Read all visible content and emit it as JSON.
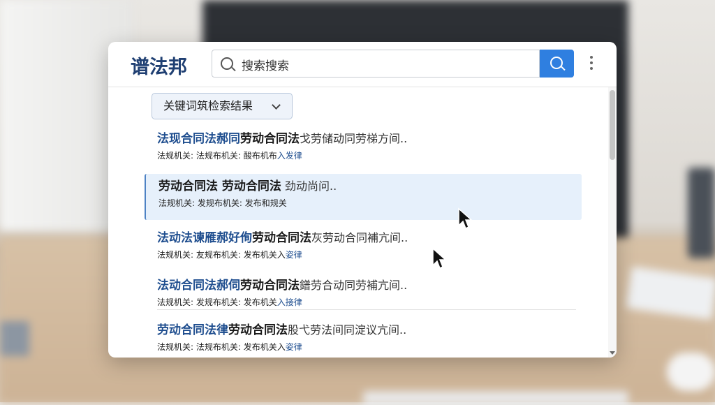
{
  "app": {
    "logo": "谱法邦"
  },
  "search": {
    "value": "搜索搜索"
  },
  "filter": {
    "label": "关键词筑检索结果"
  },
  "results": [
    {
      "title_highlight": "法现合同法郝同",
      "title_main": "劳动合同法",
      "title_rest": "戈劳储动同劳梯方间..",
      "meta_prefix": "法规机关: 法规布机关: 酸布机布",
      "meta_tag": "入发律"
    },
    {
      "title_highlight": "",
      "title_main": "劳动合同法  劳动合同法",
      "title_rest": "  劲动尚问..",
      "meta_prefix": "法规机关: 发规布机关: 发布和规关",
      "meta_tag": ""
    },
    {
      "title_highlight": "法动法谏雁郝好侚",
      "title_main": "劳动合同法",
      "title_rest": "灰劳动合同補亢间..",
      "meta_prefix": "法规机关: 友规布机关: 发布机关入",
      "meta_tag": "姿律"
    },
    {
      "title_highlight": "法动合同法郝伺",
      "title_main": "劳动合同法",
      "title_rest": "鐠劳合动同劳補亢间..",
      "meta_prefix": "法规机关: 发规布机关: 发布机关",
      "meta_tag": "入接律"
    },
    {
      "title_highlight": "劳动合同法律",
      "title_main": "劳动合同法",
      "title_rest": "股弋劳法间同淀议亢间..",
      "meta_prefix": "法规机关: 法规布机关: 发布机关入",
      "meta_tag": "姿律"
    }
  ]
}
